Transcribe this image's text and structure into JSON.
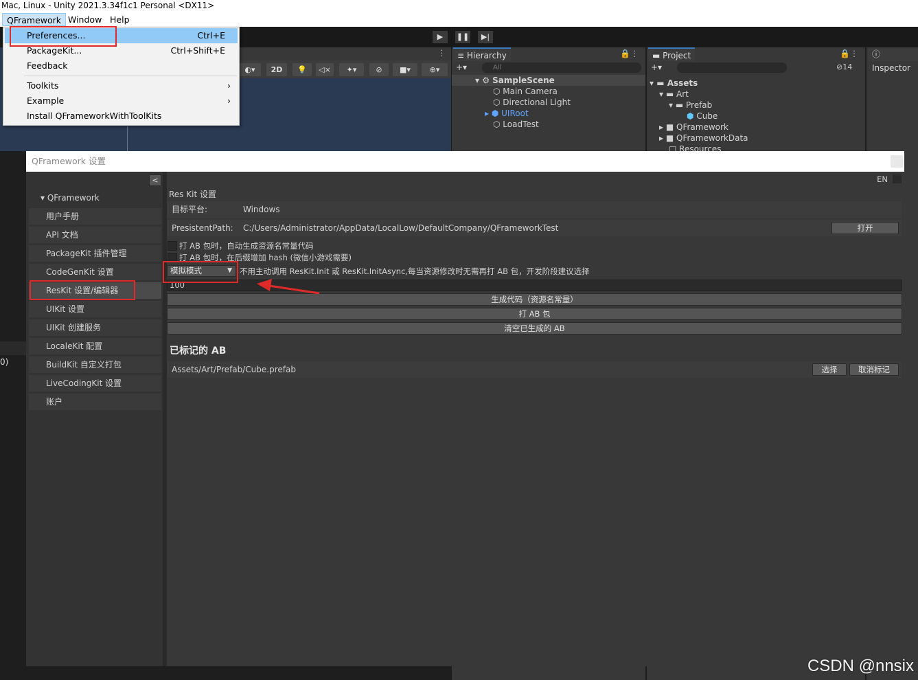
{
  "window_title": "Mac, Linux - Unity 2021.3.34f1c1 Personal <DX11>",
  "menubar": {
    "items": [
      "QFramework",
      "Window",
      "Help"
    ]
  },
  "dropdown": {
    "items": [
      {
        "label": "Preferences...",
        "shortcut": "Ctrl+E"
      },
      {
        "label": "PackageKit...",
        "shortcut": "Ctrl+Shift+E"
      },
      {
        "label": "Feedback",
        "shortcut": ""
      },
      {
        "label": "Toolkits",
        "shortcut": "›"
      },
      {
        "label": "Example",
        "shortcut": "›"
      },
      {
        "label": "Install QFrameworkWithToolKits",
        "shortcut": ""
      }
    ]
  },
  "scene_toolbar": {
    "mode_2d": "2D"
  },
  "hierarchy": {
    "tab": "Hierarchy",
    "search_placeholder": "All",
    "scene": "SampleScene",
    "items": [
      "Main Camera",
      "Directional Light",
      "UIRoot",
      "LoadTest"
    ]
  },
  "project": {
    "tab": "Project",
    "badge_count": "14",
    "tree": [
      "Assets",
      "Art",
      "Prefab",
      "Cube",
      "QFramework",
      "QFrameworkData",
      "Resources"
    ]
  },
  "inspector": {
    "tab": "Inspector"
  },
  "settings_window": {
    "title": "QFramework 设置",
    "collapse_label": "<",
    "lang_label": "EN",
    "nav": {
      "header": "QFramework",
      "items": [
        "用户手册",
        "API 文档",
        "PackageKit 插件管理",
        "CodeGenKit 设置",
        "ResKit 设置/编辑器",
        "UIKit 设置",
        "UIKit 创建服务",
        "LocaleKit 配置",
        "BuildKit 自定义打包",
        "LiveCodingKit 设置",
        "账户"
      ]
    },
    "reskit": {
      "section_title": "Res Kit 设置",
      "platform_label": "目标平台:",
      "platform_value": "Windows",
      "path_label": "PresistentPath:",
      "path_value": "C:/Users/Administrator/AppData/LocalLow/DefaultCompany/QFrameworkTest",
      "open_button": "打开",
      "checkbox1": "打 AB 包时，自动生成资源名常量代码",
      "checkbox2": "打 AB 包时，在后缀增加 hash (微信小游戏需要)",
      "mode_value": "模拟模式",
      "mode_desc": "不用主动调用 ResKit.Init 或 ResKit.InitAsync,每当资源修改时无需再打 AB 包，开发阶段建议选择",
      "number_value": "100",
      "btn_gen": "生成代码（资源名常量）",
      "btn_build": "打 AB 包",
      "btn_clear": "清空已生成的 AB",
      "marked_title": "已标记的 AB",
      "marked_item": "Assets/Art/Prefab/Cube.prefab",
      "btn_select": "选择",
      "btn_unmark": "取消标记"
    }
  },
  "left_edge_fragment": "0)",
  "watermark": "CSDN @nnsix",
  "colors": {
    "annotation_red": "#e02a2a",
    "selection_blue": "#91c9f7",
    "uiroot_blue": "#5ea3ff"
  }
}
